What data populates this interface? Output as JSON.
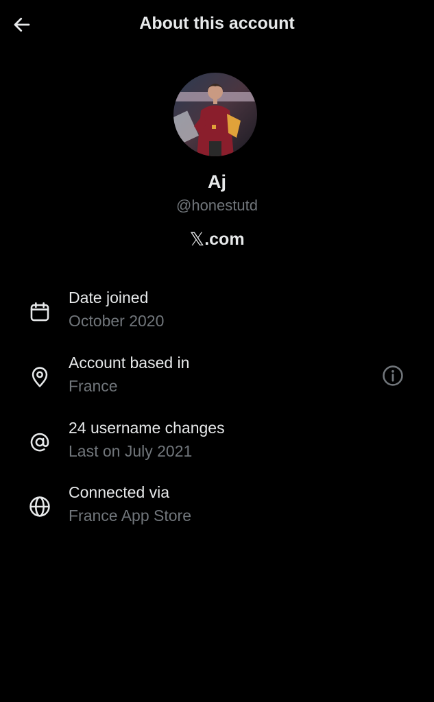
{
  "header": {
    "title": "About this account",
    "back_icon": "arrow-left-icon"
  },
  "profile": {
    "display_name": "Aj",
    "handle": "@honestutd",
    "site_glyph": "𝕏",
    "site_suffix": ".com",
    "avatar_description_colors": {
      "jacket": "#8a1e2c",
      "accent": "#e0a23a"
    }
  },
  "details": [
    {
      "icon": "calendar-icon",
      "title": "Date joined",
      "value": "October 2020"
    },
    {
      "icon": "location-pin-icon",
      "title": "Account based in",
      "value": "France",
      "info_icon": "info-circle-icon"
    },
    {
      "icon": "at-sign-icon",
      "title": "24 username changes",
      "value": "Last on July 2021"
    },
    {
      "icon": "globe-icon",
      "title": "Connected via",
      "value": "France App Store"
    }
  ],
  "colors": {
    "background": "#000000",
    "primary_text": "#e7e9ea",
    "secondary_text": "#71767b"
  }
}
